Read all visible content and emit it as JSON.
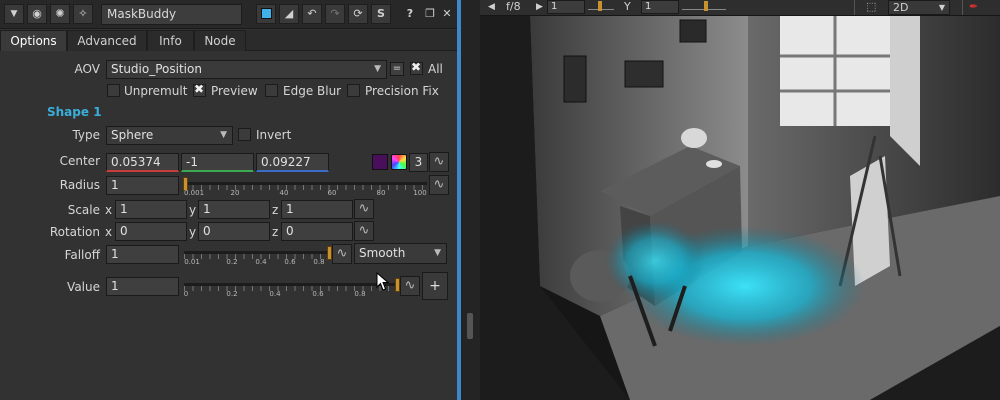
{
  "panel": {
    "node_name": "MaskBuddy",
    "toolbar_icons": [
      "collapse-arrow-icon",
      "record-icon",
      "bug-icon",
      "wrench-icon",
      "color-swatch-icon",
      "split-view-icon",
      "undo-icon",
      "redo-icon",
      "refresh-icon",
      "script-icon",
      "help-icon",
      "float-icon",
      "close-icon"
    ],
    "toolbar_glyphs": {
      "help": "?",
      "script": "S"
    },
    "tabs": [
      "Options",
      "Advanced",
      "Info",
      "Node"
    ],
    "aov": {
      "label": "AOV",
      "value": "Studio_Position",
      "minus": "=",
      "all_label": "All"
    },
    "checks": {
      "unpremult": "Unpremult",
      "preview": "Preview",
      "edge_blur": "Edge Blur",
      "precision_fix": "Precision Fix"
    },
    "section_title": "Shape 1",
    "type": {
      "label": "Type",
      "value": "Sphere",
      "invert_label": "Invert"
    },
    "center": {
      "label": "Center",
      "x": "0.05374",
      "y": "-1",
      "z": "0.09227",
      "channel_count": "3"
    },
    "radius": {
      "label": "Radius",
      "value": "1",
      "ticks": [
        "0.001",
        "20",
        "40",
        "60",
        "80",
        "100"
      ]
    },
    "scale": {
      "label": "Scale",
      "x": "1",
      "y": "1",
      "z": "1"
    },
    "rotation": {
      "label": "Rotation",
      "x": "0",
      "y": "0",
      "z": "0"
    },
    "axes": {
      "x": "x",
      "y": "y",
      "z": "z"
    },
    "falloff": {
      "label": "Falloff",
      "value": "1",
      "mode": "Smooth",
      "ticks": [
        "0.01",
        "0.2",
        "0.4",
        "0.6",
        "0.8"
      ]
    },
    "value": {
      "label": "Value",
      "value": "1",
      "ticks": [
        "0",
        "0.2",
        "0.4",
        "0.6",
        "0.8"
      ],
      "plus": "+"
    }
  },
  "viewer": {
    "fstop": "f/8",
    "frame": "1",
    "y_label": "Y",
    "y_value": "1",
    "view_mode": "2D",
    "mask_color": "#19c8e6"
  }
}
